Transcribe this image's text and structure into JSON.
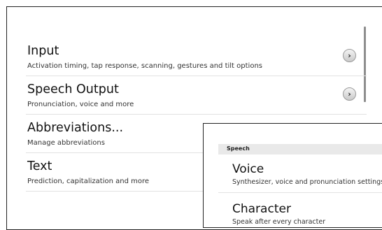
{
  "settings": {
    "items": [
      {
        "title": "Input",
        "subtitle": "Activation timing, tap response, scanning, gestures and tilt options",
        "has_arrow": true
      },
      {
        "title": "Speech Output",
        "subtitle": "Pronunciation, voice and more",
        "has_arrow": true
      },
      {
        "title": "Abbreviations...",
        "subtitle": "Manage abbreviations",
        "has_arrow": false
      },
      {
        "title": "Text",
        "subtitle": "Prediction, capitalization and more",
        "has_arrow": false
      }
    ],
    "arrow_icon": "chevron-right-icon"
  },
  "speech_panel": {
    "section_header": "Speech",
    "items": [
      {
        "title": "Voice",
        "subtitle": "Synthesizer, voice and pronunciation settings"
      },
      {
        "title": "Character",
        "subtitle": "Speak after every character"
      }
    ]
  }
}
